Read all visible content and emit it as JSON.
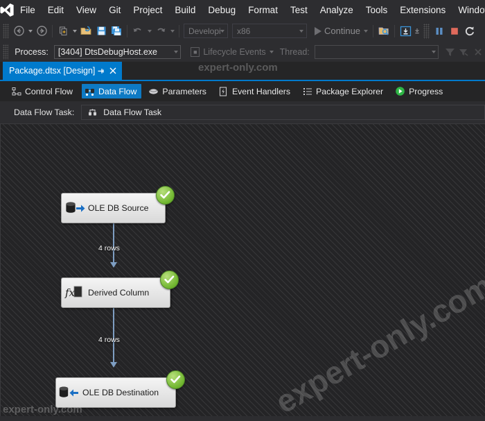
{
  "menubar": {
    "logo_icon": "visual-studio-logo",
    "items": [
      {
        "label": "File"
      },
      {
        "label": "Edit"
      },
      {
        "label": "View"
      },
      {
        "label": "Git"
      },
      {
        "label": "Project"
      },
      {
        "label": "Build"
      },
      {
        "label": "Debug"
      },
      {
        "label": "Format"
      },
      {
        "label": "Test"
      },
      {
        "label": "Analyze"
      },
      {
        "label": "Tools"
      },
      {
        "label": "Extensions"
      },
      {
        "label": "Window"
      }
    ]
  },
  "toolbar": {
    "navigate_back_icon": "back-arrow-icon",
    "navigate_forward_icon": "forward-arrow-icon",
    "new_item_icon": "new-item-icon",
    "open_file_icon": "open-folder-icon",
    "save_icon": "save-icon",
    "save_all_icon": "save-all-icon",
    "undo_icon": "undo-icon",
    "redo_icon": "redo-icon",
    "config_value": "Developi",
    "platform_value": "x86",
    "continue_label": "Continue",
    "continue_icon": "play-icon",
    "attach_icon": "attach-to-process-icon",
    "step_icon": "step-into-icon",
    "break_all_icon": "pause-icon",
    "stop_icon": "stop-icon",
    "restart_icon": "restart-icon"
  },
  "processbar": {
    "process_label": "Process:",
    "process_value": "[3404] DtsDebugHost.exe",
    "lifecycle_label": "Lifecycle Events",
    "lifecycle_icon": "lifecycle-icon",
    "thread_label": "Thread:",
    "thread_value": "",
    "filter_icon": "filter-icon",
    "filter_clear_icon": "filter-clear-icon"
  },
  "documenttab": {
    "title": "Package.dtsx [Design]",
    "pin_icon": "pin-icon",
    "close_icon": "close-icon"
  },
  "designertabs": {
    "items": [
      {
        "label": "Control Flow",
        "icon": "control-flow-icon",
        "active": false
      },
      {
        "label": "Data Flow",
        "icon": "data-flow-icon",
        "active": true
      },
      {
        "label": "Parameters",
        "icon": "parameters-icon",
        "active": false
      },
      {
        "label": "Event Handlers",
        "icon": "event-handlers-icon",
        "active": false
      },
      {
        "label": "Package Explorer",
        "icon": "package-explorer-icon",
        "active": false
      },
      {
        "label": "Progress",
        "icon": "progress-icon",
        "active": false
      }
    ]
  },
  "dataflowbar": {
    "label": "Data Flow Task:",
    "selected": "Data Flow Task",
    "icon": "data-flow-task-icon"
  },
  "canvas": {
    "components": [
      {
        "name": "OLE DB Source",
        "icon": "ole-db-source-icon",
        "status": "success"
      },
      {
        "name": "Derived Column",
        "icon": "derived-column-icon",
        "status": "success"
      },
      {
        "name": "OLE DB Destination",
        "icon": "ole-db-destination-icon",
        "status": "success"
      }
    ],
    "connectors": [
      {
        "label": "4 rows"
      },
      {
        "label": "4 rows"
      }
    ],
    "status_icon": "green-check-icon"
  },
  "watermarks": {
    "top": "expert-only.com",
    "big": "expert-only.com",
    "bottom": "expert-only.com"
  },
  "colors": {
    "accent": "#007acc",
    "chrome": "#2d2d30",
    "canvas": "#242426",
    "success": "#6fb52e",
    "connector": "#7e9ec2"
  }
}
